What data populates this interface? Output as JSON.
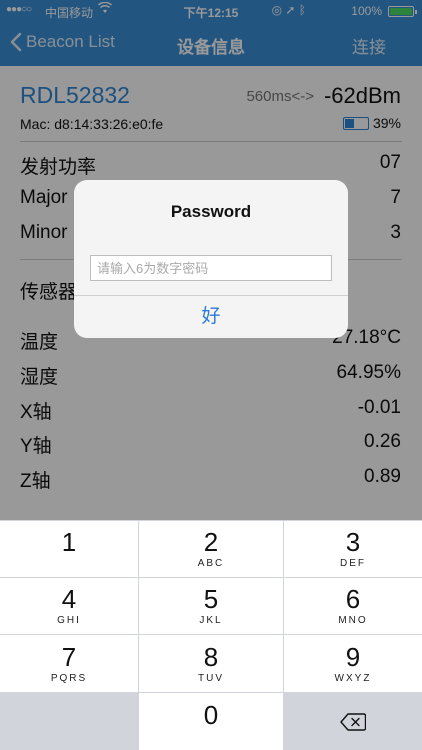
{
  "status_bar": {
    "signal": "●●●○○",
    "carrier": "中国移动",
    "time": "下午12:15",
    "battery_pct": "100%"
  },
  "nav": {
    "back_label": "Beacon List",
    "title": "设备信息",
    "connect_label": "连接"
  },
  "device": {
    "name": "RDL52832",
    "interval": "560ms<->",
    "rssi": "-62dBm",
    "mac": "Mac: d8:14:33:26:e0:fe",
    "battery": "39%",
    "battery_level": 0.39
  },
  "beacon": {
    "tx_power_label": "发射功率",
    "tx_power_value": "07",
    "major_label": "Major",
    "major_value": "7",
    "minor_label": "Minor",
    "minor_value": "3"
  },
  "sensor": {
    "section_label": "传感器",
    "rows": [
      {
        "label": "温度",
        "value": "27.18°C"
      },
      {
        "label": "湿度",
        "value": "64.95%"
      },
      {
        "label": "X轴",
        "value": "-0.01"
      },
      {
        "label": "Y轴",
        "value": "0.26"
      },
      {
        "label": "Z轴",
        "value": "0.89"
      }
    ]
  },
  "alert": {
    "title": "Password",
    "input_placeholder": "请输入6为数字密码",
    "input_value": "",
    "ok_label": "好"
  },
  "keypad": {
    "keys": [
      {
        "num": "1",
        "letters": ""
      },
      {
        "num": "2",
        "letters": "ABC"
      },
      {
        "num": "3",
        "letters": "DEF"
      },
      {
        "num": "4",
        "letters": "GHI"
      },
      {
        "num": "5",
        "letters": "JKL"
      },
      {
        "num": "6",
        "letters": "MNO"
      },
      {
        "num": "7",
        "letters": "PQRS"
      },
      {
        "num": "8",
        "letters": "TUV"
      },
      {
        "num": "9",
        "letters": "WXYZ"
      },
      {
        "num": "0",
        "letters": ""
      }
    ]
  },
  "colors": {
    "nav_bg": "#3a8fd8",
    "accent": "#2e86d6",
    "alert_button": "#2e7ad6",
    "battery_green": "#4cd964"
  }
}
